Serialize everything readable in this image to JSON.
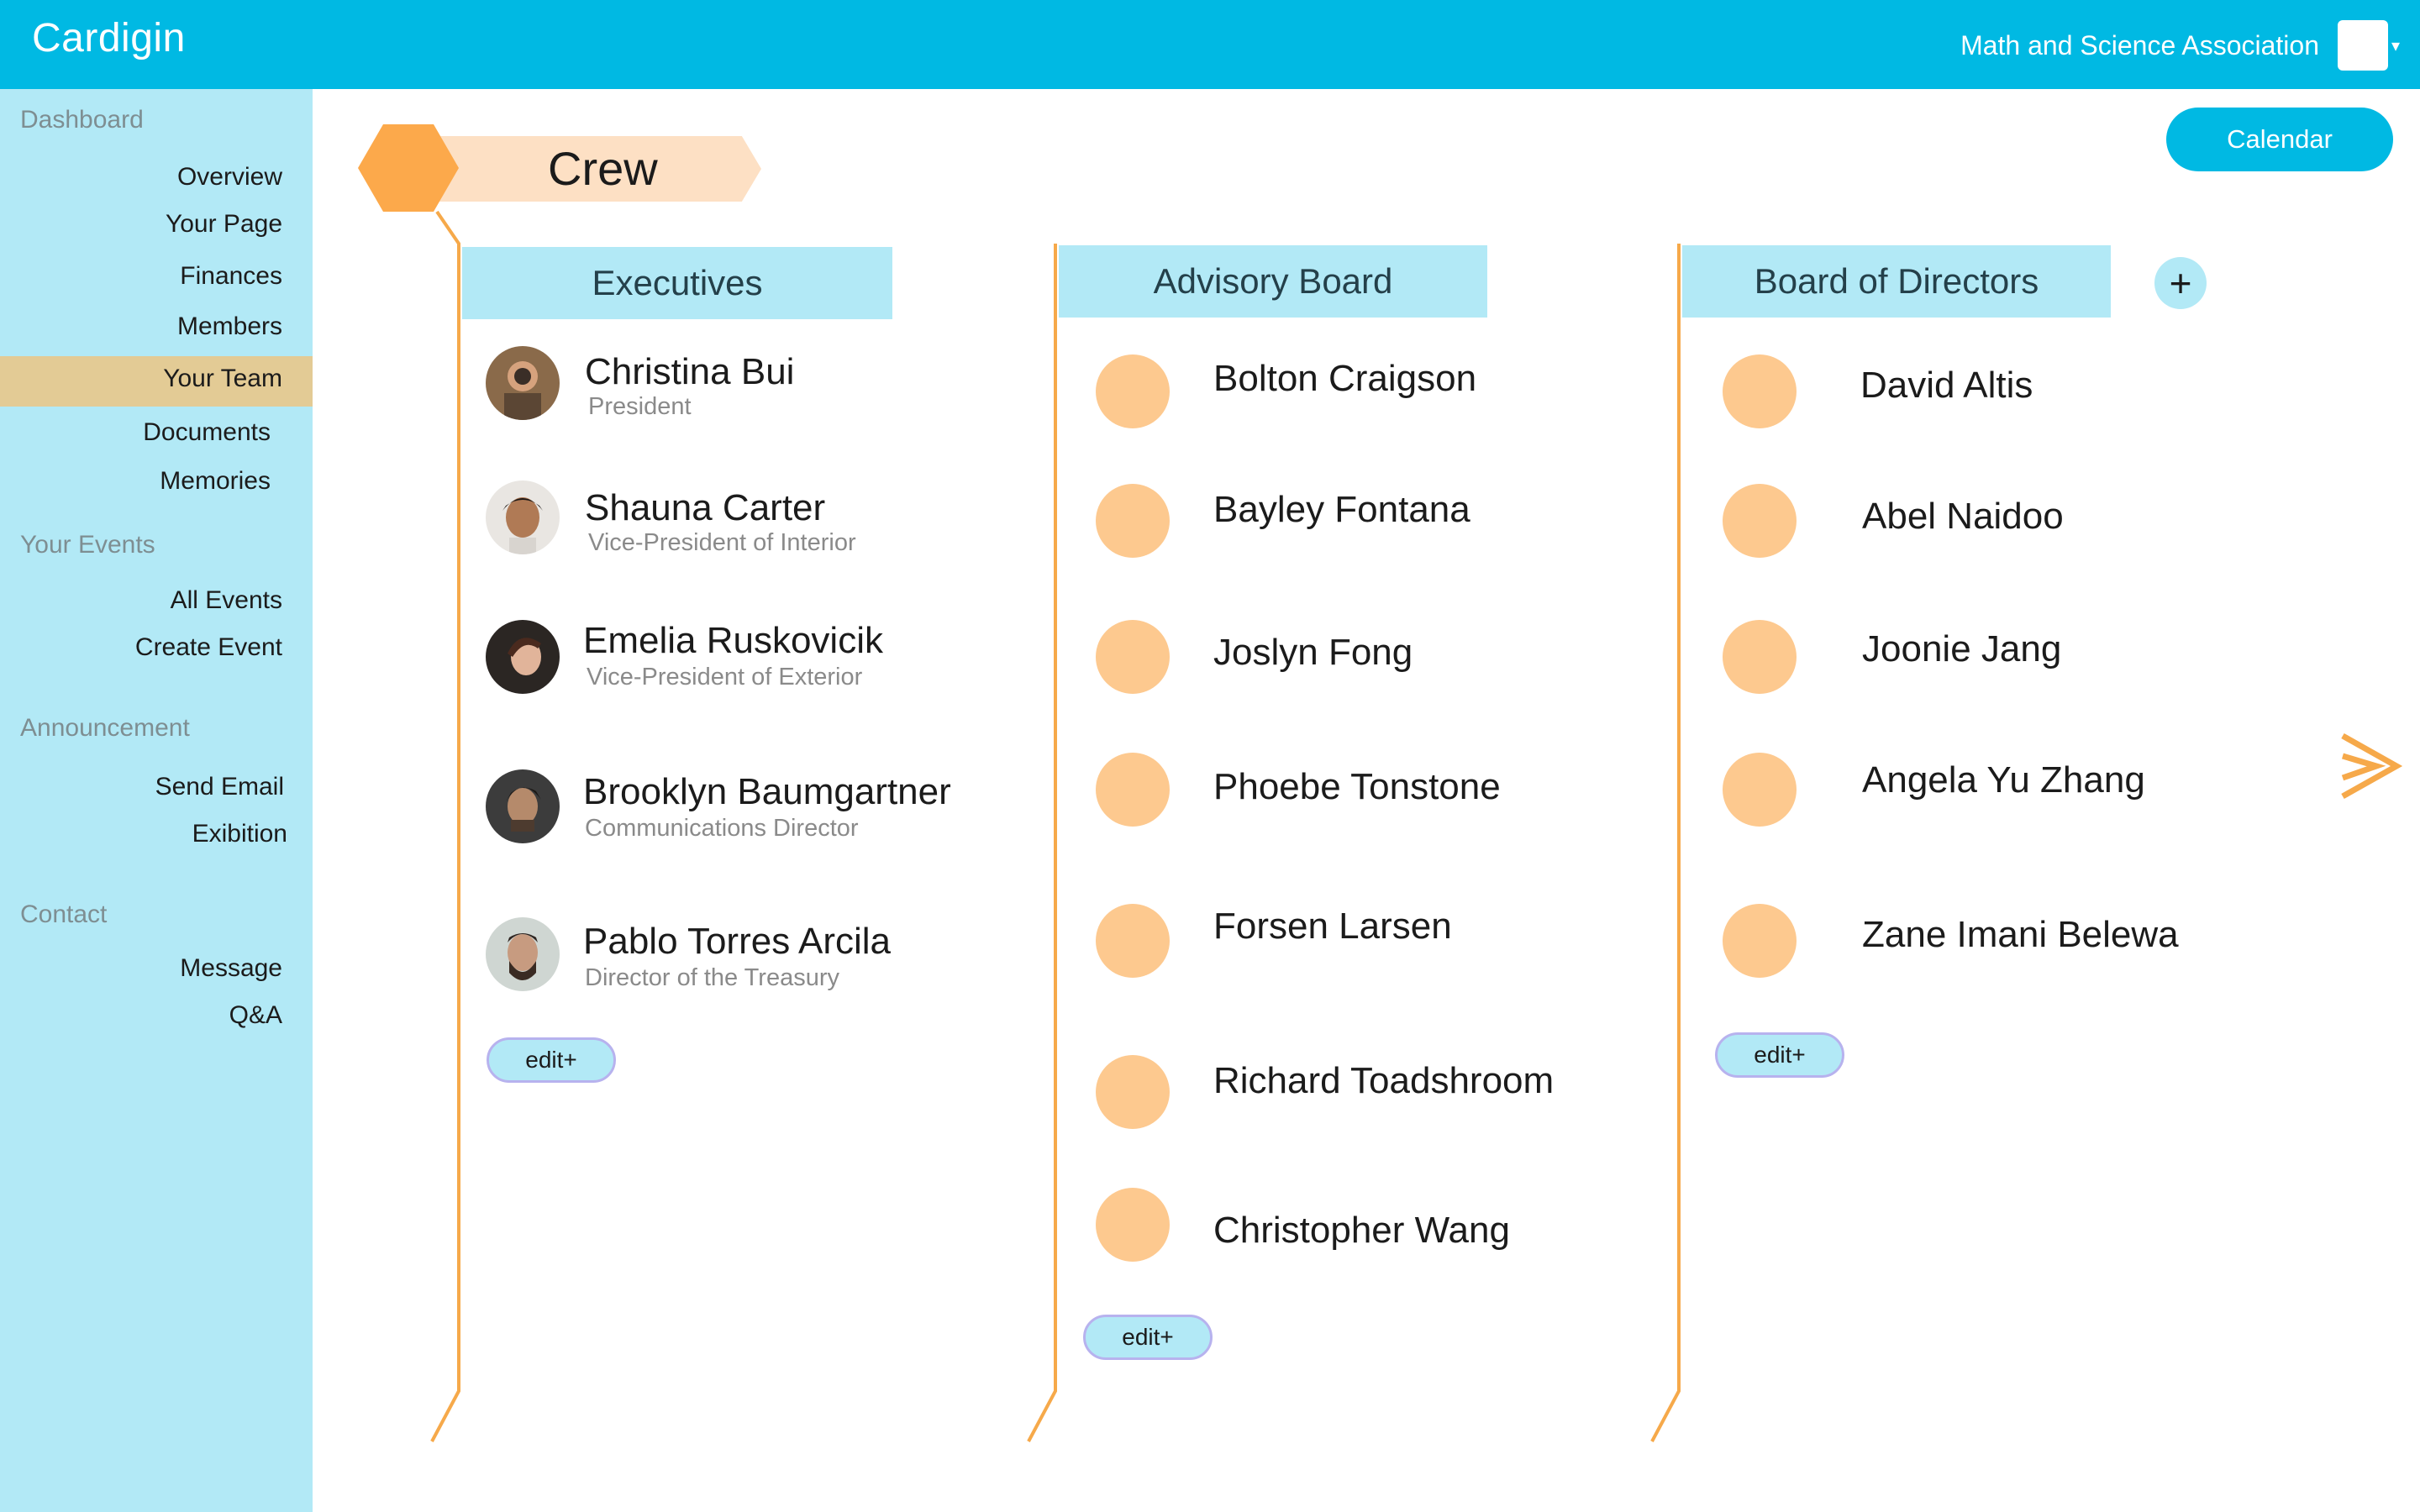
{
  "app": {
    "title": "Cardigin"
  },
  "header": {
    "organization": "Math and Science Association",
    "chevron": "▾"
  },
  "sidebar": {
    "sections": [
      {
        "label": "Dashboard"
      },
      {
        "label": "Your Events"
      },
      {
        "label": "Announcement"
      },
      {
        "label": "Contact"
      }
    ],
    "items": [
      {
        "label": "Overview"
      },
      {
        "label": "Your Page"
      },
      {
        "label": "Finances"
      },
      {
        "label": "Members"
      },
      {
        "label": "Your Team",
        "active": true
      },
      {
        "label": "Documents"
      },
      {
        "label": "Memories"
      },
      {
        "label": "All Events"
      },
      {
        "label": "Create Event"
      },
      {
        "label": "Send Email"
      },
      {
        "label": "Exibition"
      },
      {
        "label": "Message"
      },
      {
        "label": "Q&A"
      }
    ]
  },
  "main": {
    "calendar_label": "Calendar",
    "crew_title": "Crew",
    "add_label": "+",
    "edit_label": "edit+",
    "columns": [
      {
        "title": "Executives",
        "members": [
          {
            "name": "Christina Bui",
            "role": "President"
          },
          {
            "name": "Shauna Carter",
            "role": "Vice-President of Interior"
          },
          {
            "name": "Emelia Ruskovicik",
            "role": "Vice-President of Exterior"
          },
          {
            "name": "Brooklyn Baumgartner",
            "role": "Communications Director"
          },
          {
            "name": "Pablo Torres Arcila",
            "role": "Director of the Treasury"
          }
        ]
      },
      {
        "title": "Advisory Board",
        "members": [
          {
            "name": "Bolton Craigson"
          },
          {
            "name": "Bayley Fontana"
          },
          {
            "name": "Joslyn Fong"
          },
          {
            "name": "Phoebe Tonstone"
          },
          {
            "name": "Forsen Larsen"
          },
          {
            "name": "Richard Toadshroom"
          },
          {
            "name": "Christopher Wang"
          }
        ]
      },
      {
        "title": "Board of Directors",
        "members": [
          {
            "name": "David Altis"
          },
          {
            "name": "Abel Naidoo"
          },
          {
            "name": "Joonie Jang"
          },
          {
            "name": "Angela Yu Zhang"
          },
          {
            "name": "Zane Imani Belewa"
          }
        ]
      }
    ]
  },
  "colors": {
    "brand": "#00b9e3",
    "sidebar": "#b2e9f6",
    "active_item": "#e3cb95",
    "accent_orange": "#f6a94a",
    "placeholder_avatar": "#fdc98f"
  }
}
